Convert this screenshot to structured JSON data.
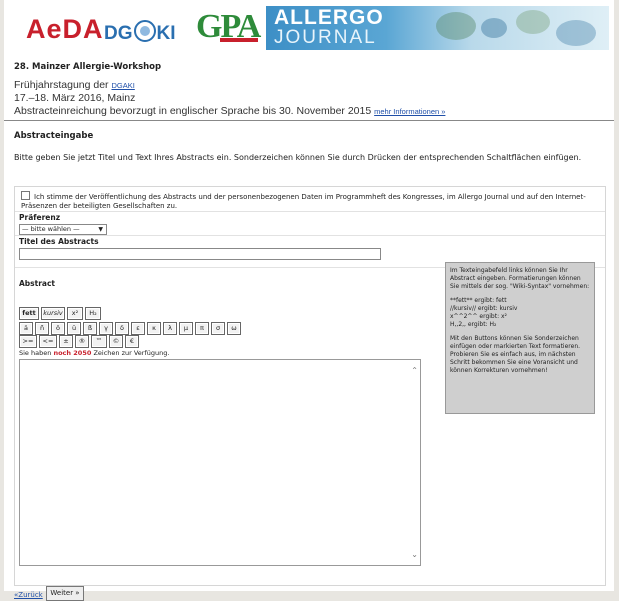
{
  "logos": {
    "aeda": "AeDA",
    "dgaki_pre": "DG",
    "dgaki_post": "KI",
    "gpa": "GPA",
    "allergo_title": "ALLERGO",
    "allergo_sub": "JOURNAL"
  },
  "workshop": {
    "title": "28. Mainzer Allergie-Workshop",
    "line1_text": "Frühjahrstagung der",
    "line1_link": "DGAKI",
    "line2": "17.–18. März 2016, Mainz",
    "line3_text": "Abstracteinreichung bevorzugt in englischer Sprache bis 30. November 2015",
    "line3_link": "mehr Informationen »"
  },
  "abstract_section": {
    "title": "Abstracteingabe",
    "intro": "Bitte geben Sie jetzt Titel und Text Ihres Abstracts ein. Sonderzeichen können Sie durch Drücken der entsprechenden Schaltflächen einfügen."
  },
  "form": {
    "consent": "Ich stimme der Veröffentlichung des Abstracts und der personenbezogenen Daten im Programmheft des Kongresses, im Allergo Journal und auf den Internet-Präsenzen der beteiligten Gesellschaften zu.",
    "preference_label": "Präferenz",
    "preference_value": "— bitte wählen —",
    "title_label": "Titel des Abstracts",
    "abstract_label": "Abstract",
    "format_buttons": [
      "fett",
      "kursiv",
      "x²",
      "H₂"
    ],
    "char_buttons_row1": [
      "ä",
      "ñ",
      "ö",
      "ü",
      "ß",
      "γ",
      "δ",
      "ε",
      "κ",
      "λ",
      "μ",
      "π",
      "σ",
      "ω"
    ],
    "char_buttons_row2": [
      ">=",
      "<=",
      "±",
      "®",
      "™",
      "©",
      "€"
    ],
    "remaining_prefix": "Sie haben",
    "remaining_count": "noch 2050",
    "remaining_suffix": "Zeichen zur Verfügung."
  },
  "help": {
    "p1": "Im Texteingabefeld links können Sie Ihr Abstract eingeben. Formatierungen können Sie mittels der sog. \"Wiki-Syntax\" vornehmen:",
    "p2a": "**fett** ergibt: fett",
    "p2b": "//kursiv// ergibt: kursiv",
    "p2c": "x^^2^^ ergibt: x²",
    "p2d": "H,,2,, ergibt: H₂",
    "p3": "Mit den Buttons können Sie Sonderzeichen einfügen oder markierten Text formatieren. Probieren Sie es einfach aus, im nächsten Schritt bekommen Sie eine Voransicht und können Korrekturen vornehmen!"
  },
  "nav": {
    "back": "«Zurück",
    "next": "Weiter »"
  },
  "colors": {
    "brand_red": "#c8202c",
    "brand_blue": "#2a6fb0",
    "brand_green": "#2e8b3a",
    "link": "#1f4fa8"
  }
}
